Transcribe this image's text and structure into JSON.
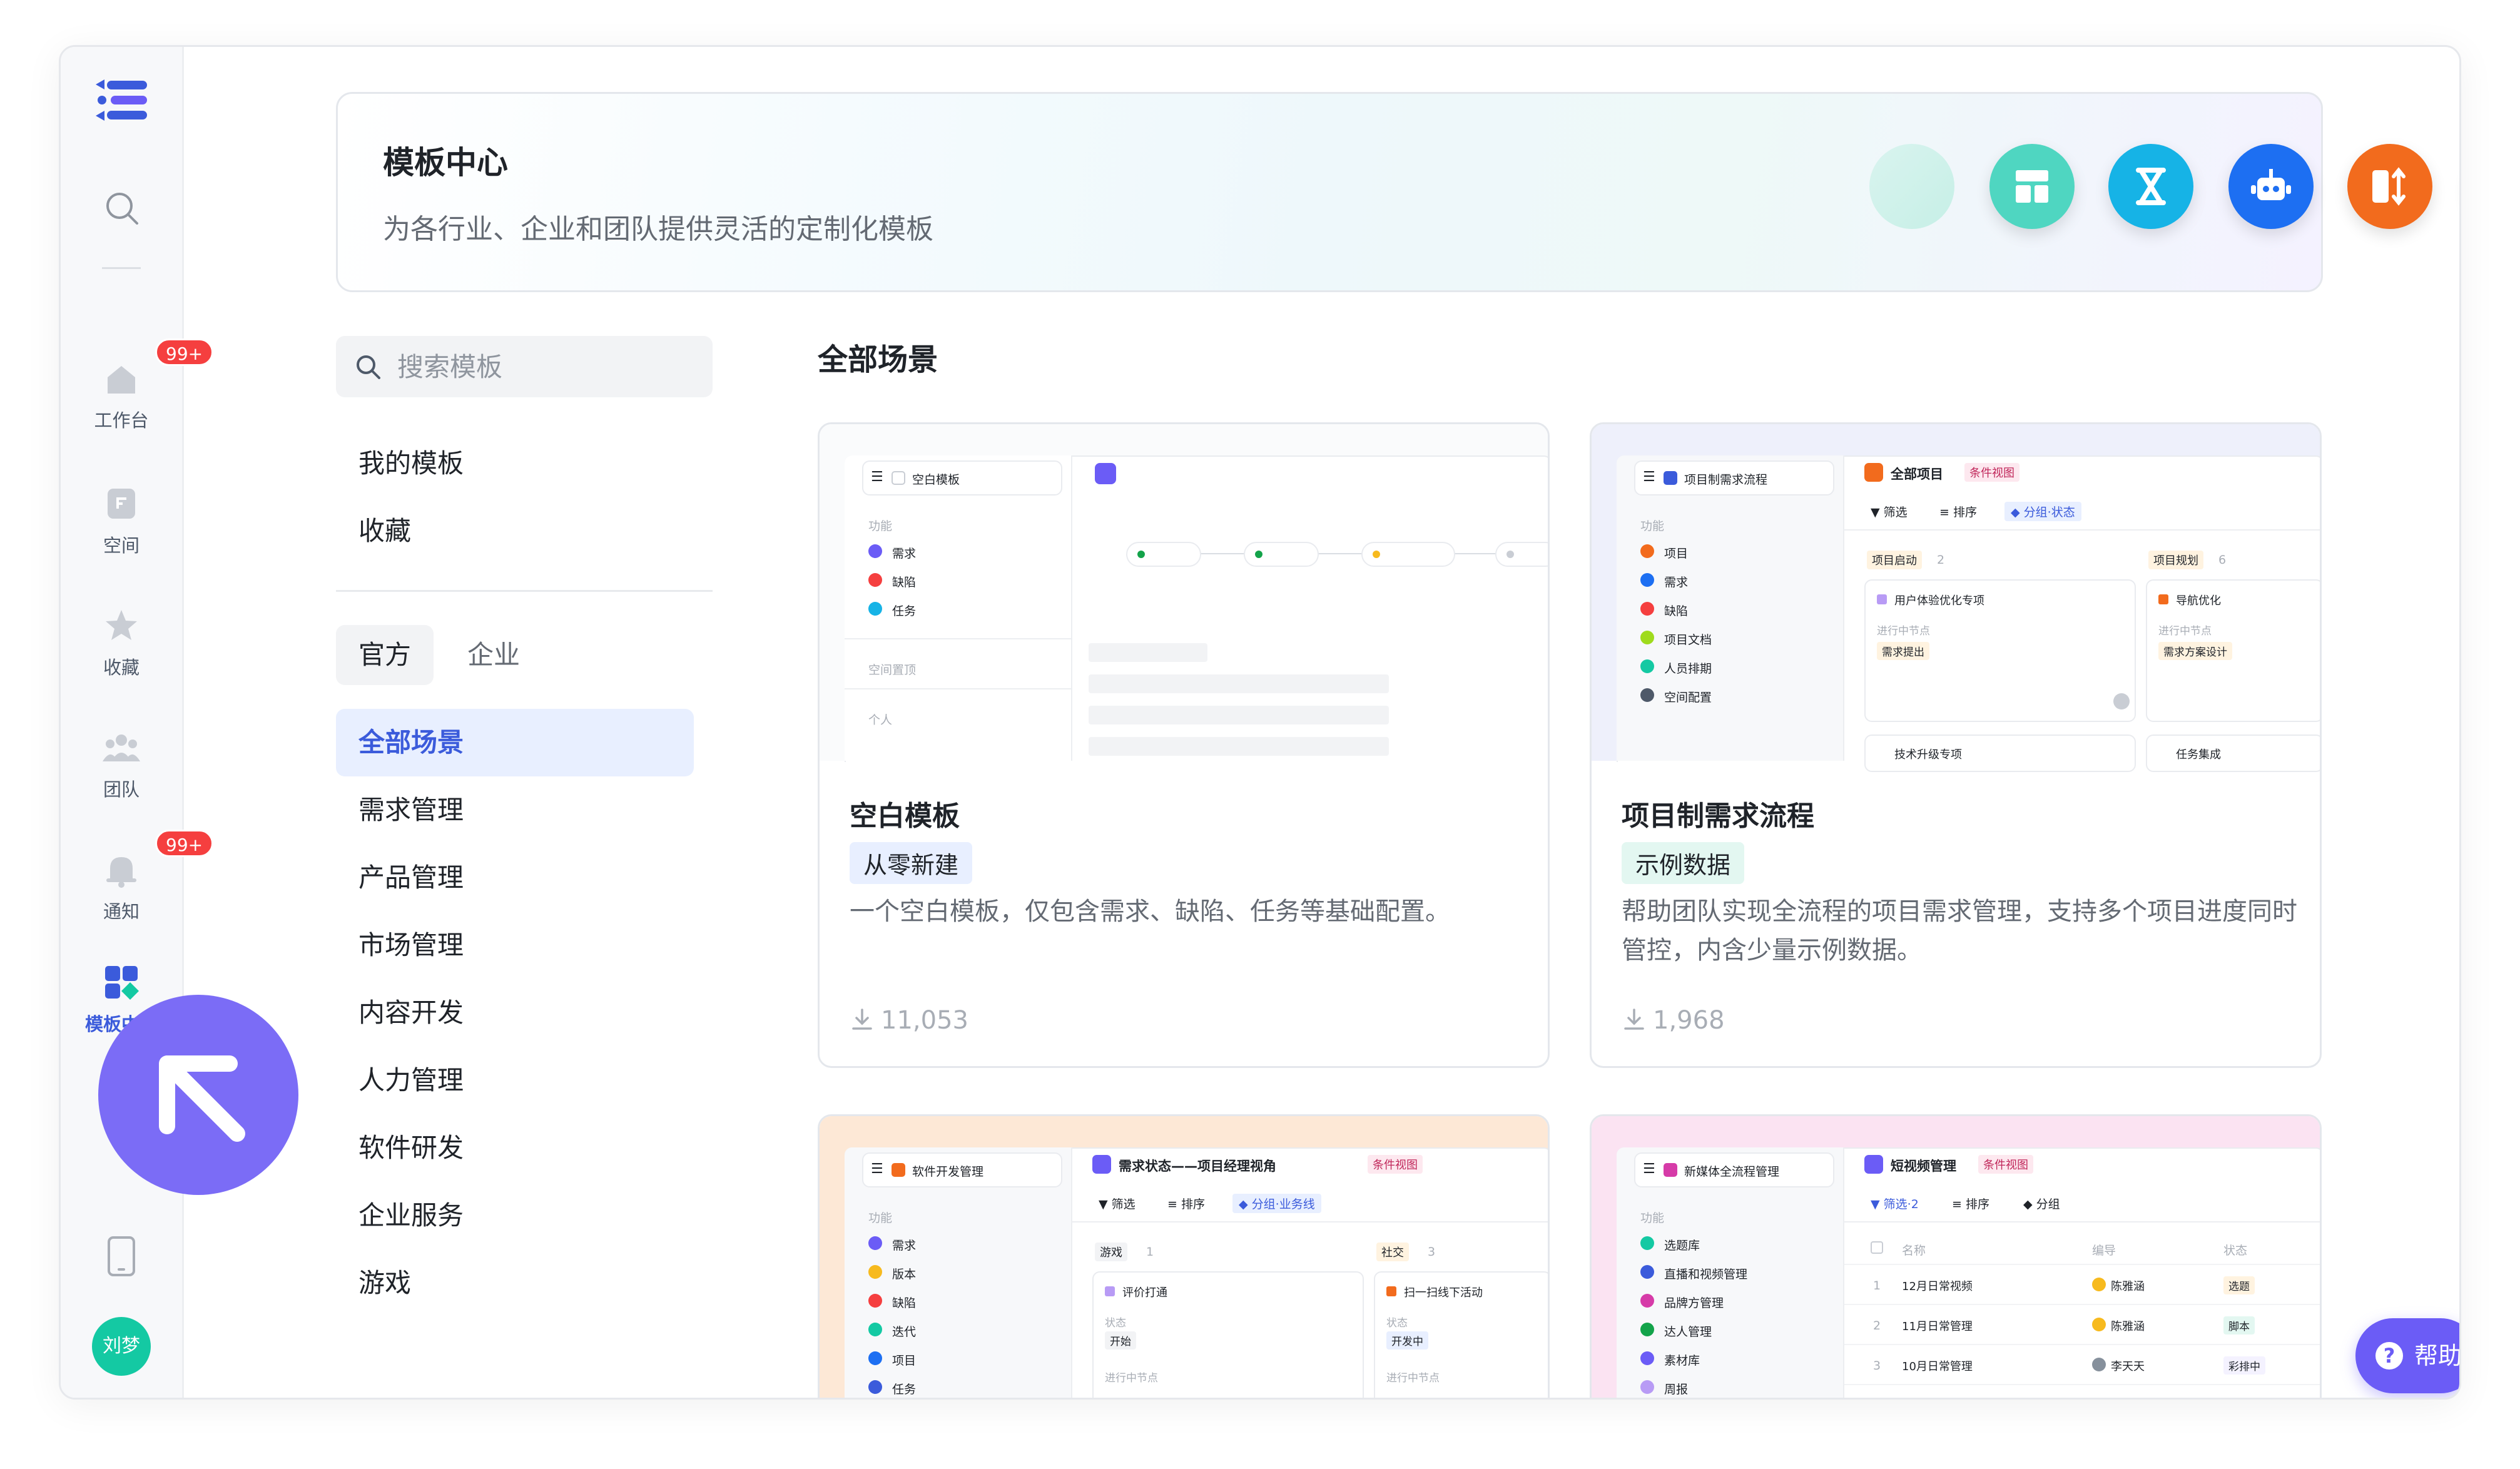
{
  "sidebar": {
    "items": [
      {
        "label": "工作台",
        "badge": "99+"
      },
      {
        "label": "空间"
      },
      {
        "label": "收藏"
      },
      {
        "label": "团队"
      },
      {
        "label": "通知",
        "badge": "99+"
      },
      {
        "label": "模板中心",
        "active": true
      }
    ],
    "avatar": "刘梦"
  },
  "banner": {
    "title": "模板中心",
    "subtitle": "为各行业、企业和团队提供灵活的定制化模板"
  },
  "filter": {
    "search_placeholder": "搜索模板",
    "links": [
      "我的模板",
      "收藏"
    ],
    "segments": [
      "官方",
      "企业"
    ],
    "categories": [
      "全部场景",
      "需求管理",
      "产品管理",
      "市场管理",
      "内容开发",
      "人力管理",
      "软件研发",
      "企业服务",
      "游戏"
    ]
  },
  "main": {
    "section_title": "全部场景",
    "cards": [
      {
        "title": "空白模板",
        "tag": "从零新建",
        "description": "一个空白模板，仅包含需求、缺陷、任务等基础配置。",
        "downloads": "11,053",
        "preview": {
          "space": "空白模板",
          "group": "功能",
          "items": [
            "需求",
            "缺陷",
            "任务"
          ],
          "extra": [
            "空间置顶",
            "个人"
          ]
        }
      },
      {
        "title": "项目制需求流程",
        "tag": "示例数据",
        "description": "帮助团队实现全流程的项目需求管理，支持多个项目进度同时管控，内含少量示例数据。",
        "downloads": "1,968",
        "preview": {
          "space": "项目制需求流程",
          "group": "功能",
          "items": [
            "项目",
            "需求",
            "缺陷",
            "项目文档",
            "人员排期",
            "空间配置"
          ],
          "view": "全部项目",
          "view_tag": "条件视图",
          "toolbar": [
            "筛选",
            "排序",
            "分组·状态"
          ],
          "columns": [
            {
              "name": "项目启动",
              "count": "2",
              "card": "用户体验优化专项",
              "node_label": "进行中节点",
              "node": "需求提出",
              "next": "技术升级专项"
            },
            {
              "name": "项目规划",
              "count": "6",
              "card": "导航优化",
              "node_label": "进行中节点",
              "node": "需求方案设计",
              "next": "任务集成"
            }
          ]
        }
      },
      {
        "preview": {
          "space": "软件开发管理",
          "group": "功能",
          "items": [
            "需求",
            "版本",
            "缺陷",
            "迭代",
            "项目",
            "任务"
          ],
          "view": "需求状态——项目经理视角",
          "view_tag": "条件视图",
          "toolbar": [
            "筛选",
            "排序",
            "分组·业务线"
          ],
          "columns": [
            {
              "name": "游戏",
              "count": "1",
              "card": "评价打通",
              "state_label": "状态",
              "state": "开始",
              "node_label": "进行中节点"
            },
            {
              "name": "社交",
              "count": "3",
              "card": "扫一扫线下活动",
              "state_label": "状态",
              "state": "开发中",
              "node_label": "进行中节点"
            }
          ]
        }
      },
      {
        "preview": {
          "space": "新媒体全流程管理",
          "group": "功能",
          "items": [
            "选题库",
            "直播和视频管理",
            "品牌方管理",
            "达人管理",
            "素材库",
            "周报"
          ],
          "view": "短视频管理",
          "view_tag": "条件视图",
          "toolbar": [
            "筛选·2",
            "排序",
            "分组"
          ],
          "headers": [
            "名称",
            "编导",
            "状态"
          ],
          "rows": [
            {
              "no": "1",
              "name": "12月日常视频",
              "owner": "陈雅涵",
              "status": "选题"
            },
            {
              "no": "2",
              "name": "11月日常管理",
              "owner": "陈雅涵",
              "status": "脚本"
            },
            {
              "no": "3",
              "name": "10月日常管理",
              "owner": "李天天",
              "status": "彩排中"
            }
          ]
        }
      }
    ]
  },
  "help": "帮助",
  "colors": {
    "accent": "#3b5bdb",
    "fab": "#7b6cf6",
    "help": "#6b5cf6",
    "badge": "#f53f3f"
  }
}
